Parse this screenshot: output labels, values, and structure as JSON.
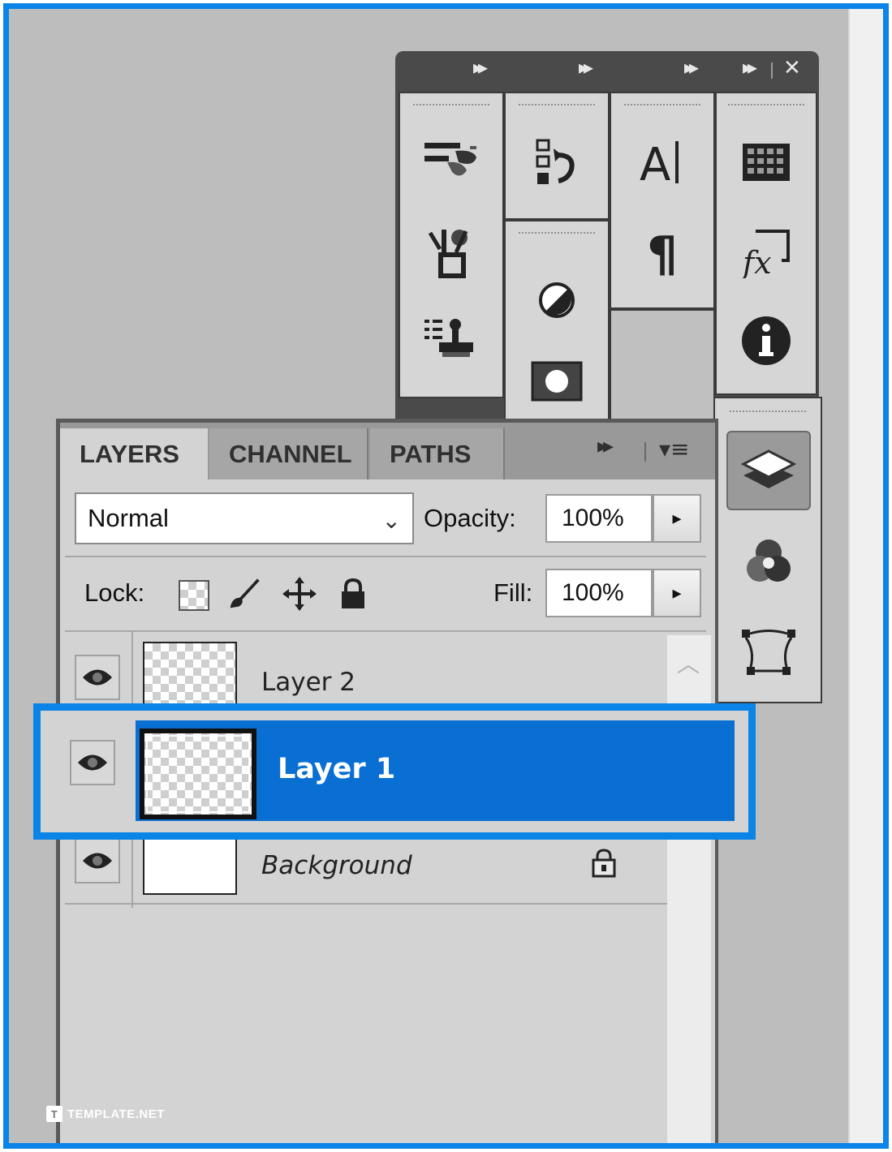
{
  "dock": {
    "header_arrows": "▸▸",
    "close_symbol": "✕",
    "icons": [
      "brushes-icon",
      "history-icon",
      "character-icon",
      "swatches-icon",
      "tool-presets-icon",
      "paragraph-icon",
      "styles-icon",
      "clone-source-icon",
      "adjustments-icon",
      "info-icon",
      "masks-icon"
    ]
  },
  "layers_panel": {
    "tabs": [
      {
        "label": "LAYERS",
        "active": true
      },
      {
        "label": "CHANNEL",
        "active": false
      },
      {
        "label": "PATHS",
        "active": false
      }
    ],
    "tab_arrows": "▸▸",
    "menu_symbol": "▾≡",
    "blend_mode": "Normal",
    "opacity_label": "Opacity:",
    "opacity_value": "100%",
    "lock_label": "Lock:",
    "fill_label": "Fill:",
    "fill_value": "100%",
    "arrow_symbol": "▸",
    "layers": [
      {
        "name": "Layer 2",
        "visible": true,
        "selected": false,
        "locked": false
      },
      {
        "name": "Layer 1",
        "visible": true,
        "selected": true,
        "locked": false
      },
      {
        "name": "Background",
        "visible": true,
        "selected": false,
        "locked": true
      }
    ]
  },
  "mini_dock": {
    "icons": [
      "layers-icon",
      "channels-icon",
      "paths-icon"
    ],
    "active": "layers-icon"
  },
  "watermark": {
    "logo": "T",
    "text": "TEMPLATE.NET"
  },
  "colors": {
    "highlight_border": "#0a84e6",
    "selected_row": "#0a6fd2",
    "panel_bg": "#d3d3d3"
  }
}
